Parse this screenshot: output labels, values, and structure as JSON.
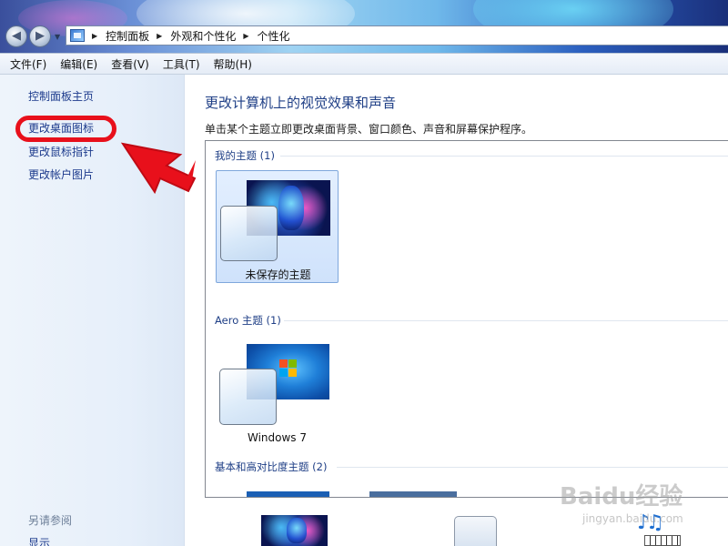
{
  "address_bar": {
    "crumbs": [
      "控制面板",
      "外观和个性化",
      "个性化"
    ]
  },
  "menu": {
    "items": [
      "文件(F)",
      "编辑(E)",
      "查看(V)",
      "工具(T)",
      "帮助(H)"
    ]
  },
  "sidebar": {
    "home": "控制面板主页",
    "links": [
      "更改桌面图标",
      "更改鼠标指针",
      "更改帐户图片"
    ],
    "see_also": "另请参阅",
    "display": "显示"
  },
  "main": {
    "title": "更改计算机上的视觉效果和声音",
    "description": "单击某个主题立即更改桌面背景、窗口颜色、声音和屏幕保护程序。",
    "groups": [
      {
        "header": "我的主题 (1)",
        "themes": [
          "未保存的主题"
        ]
      },
      {
        "header": "Aero 主题 (1)",
        "themes": [
          "Windows 7"
        ]
      },
      {
        "header": "基本和高对比度主题 (2)",
        "themes": []
      }
    ]
  },
  "watermark": {
    "logo": "Baidu经验",
    "url": "jingyan.baidu.com"
  },
  "colors": {
    "link": "#1c3a8c",
    "highlight_ring": "#e8101b",
    "selected_tile": "#cfe2fb"
  }
}
